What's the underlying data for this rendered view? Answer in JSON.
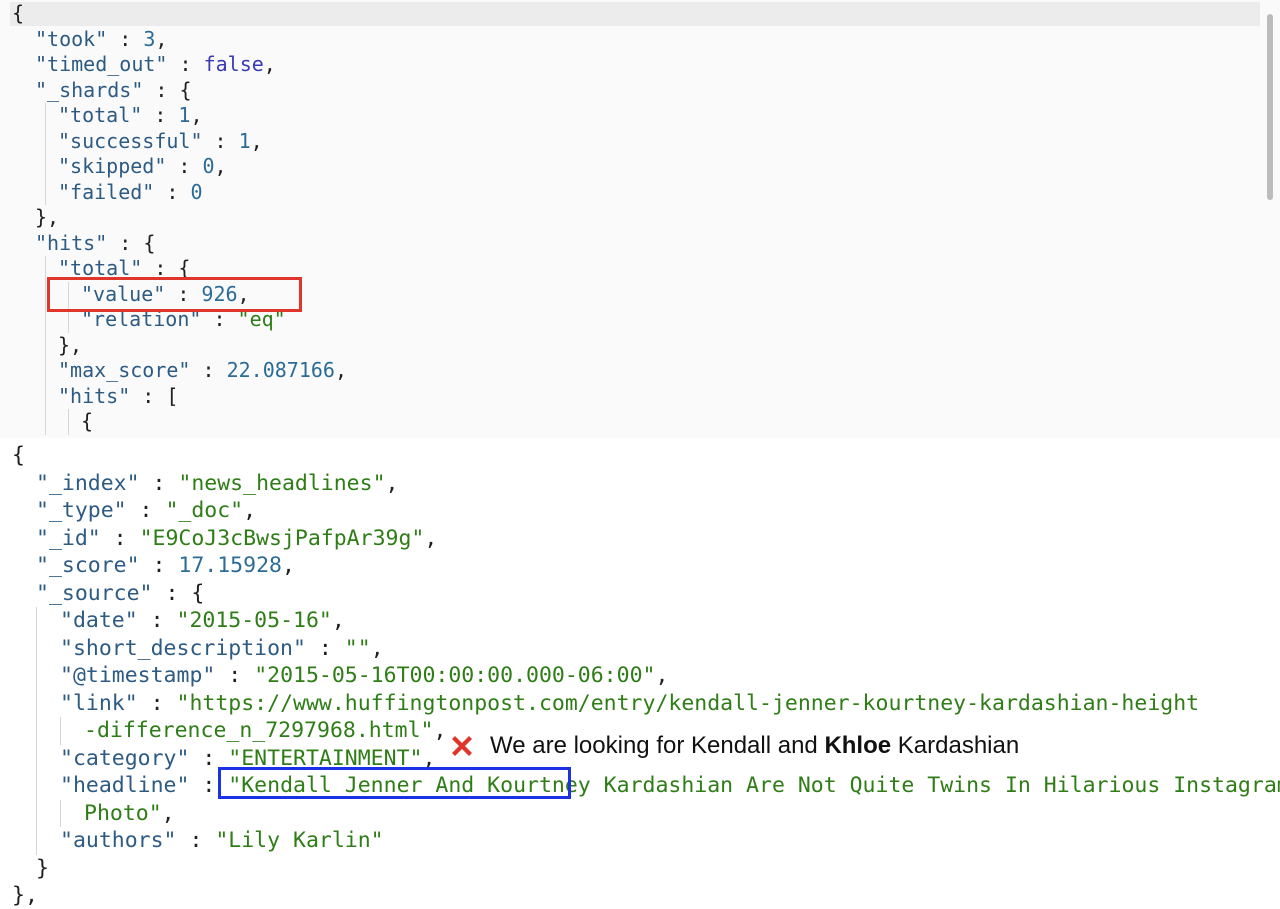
{
  "top_panel": {
    "lines": [
      {
        "indent": 0,
        "tokens": [
          {
            "t": "{",
            "c": "p"
          }
        ]
      },
      {
        "indent": 1,
        "tokens": [
          {
            "t": "\"took\"",
            "c": "k"
          },
          {
            "t": " : ",
            "c": "p"
          },
          {
            "t": "3",
            "c": "n"
          },
          {
            "t": ",",
            "c": "p"
          }
        ]
      },
      {
        "indent": 1,
        "tokens": [
          {
            "t": "\"timed_out\"",
            "c": "k"
          },
          {
            "t": " : ",
            "c": "p"
          },
          {
            "t": "false",
            "c": "b"
          },
          {
            "t": ",",
            "c": "p"
          }
        ]
      },
      {
        "indent": 1,
        "tokens": [
          {
            "t": "\"_shards\"",
            "c": "k"
          },
          {
            "t": " : {",
            "c": "p"
          }
        ]
      },
      {
        "indent": 2,
        "tokens": [
          {
            "t": "\"total\"",
            "c": "k"
          },
          {
            "t": " : ",
            "c": "p"
          },
          {
            "t": "1",
            "c": "n"
          },
          {
            "t": ",",
            "c": "p"
          }
        ]
      },
      {
        "indent": 2,
        "tokens": [
          {
            "t": "\"successful\"",
            "c": "k"
          },
          {
            "t": " : ",
            "c": "p"
          },
          {
            "t": "1",
            "c": "n"
          },
          {
            "t": ",",
            "c": "p"
          }
        ]
      },
      {
        "indent": 2,
        "tokens": [
          {
            "t": "\"skipped\"",
            "c": "k"
          },
          {
            "t": " : ",
            "c": "p"
          },
          {
            "t": "0",
            "c": "n"
          },
          {
            "t": ",",
            "c": "p"
          }
        ]
      },
      {
        "indent": 2,
        "tokens": [
          {
            "t": "\"failed\"",
            "c": "k"
          },
          {
            "t": " : ",
            "c": "p"
          },
          {
            "t": "0",
            "c": "n"
          }
        ]
      },
      {
        "indent": 1,
        "tokens": [
          {
            "t": "},",
            "c": "p"
          }
        ]
      },
      {
        "indent": 1,
        "tokens": [
          {
            "t": "\"hits\"",
            "c": "k"
          },
          {
            "t": " : {",
            "c": "p"
          }
        ]
      },
      {
        "indent": 2,
        "tokens": [
          {
            "t": "\"total\"",
            "c": "k"
          },
          {
            "t": " : {",
            "c": "p"
          }
        ]
      },
      {
        "indent": 3,
        "tokens": [
          {
            "t": "\"value\"",
            "c": "k"
          },
          {
            "t": " : ",
            "c": "p"
          },
          {
            "t": "926",
            "c": "n"
          },
          {
            "t": ",",
            "c": "p"
          }
        ]
      },
      {
        "indent": 3,
        "tokens": [
          {
            "t": "\"relation\"",
            "c": "k"
          },
          {
            "t": " : ",
            "c": "p"
          },
          {
            "t": "\"eq\"",
            "c": "s"
          }
        ]
      },
      {
        "indent": 2,
        "tokens": [
          {
            "t": "},",
            "c": "p"
          }
        ]
      },
      {
        "indent": 2,
        "tokens": [
          {
            "t": "\"max_score\"",
            "c": "k"
          },
          {
            "t": " : ",
            "c": "p"
          },
          {
            "t": "22.087166",
            "c": "n"
          },
          {
            "t": ",",
            "c": "p"
          }
        ]
      },
      {
        "indent": 2,
        "tokens": [
          {
            "t": "\"hits\"",
            "c": "k"
          },
          {
            "t": " : [",
            "c": "p"
          }
        ]
      },
      {
        "indent": 3,
        "tokens": [
          {
            "t": "{",
            "c": "p"
          }
        ]
      }
    ]
  },
  "bottom_panel": {
    "lines": [
      {
        "indent": 0,
        "tokens": [
          {
            "t": "{",
            "c": "p"
          }
        ]
      },
      {
        "indent": 1,
        "tokens": [
          {
            "t": "\"_index\"",
            "c": "k"
          },
          {
            "t": " : ",
            "c": "p"
          },
          {
            "t": "\"news_headlines\"",
            "c": "s"
          },
          {
            "t": ",",
            "c": "p"
          }
        ]
      },
      {
        "indent": 1,
        "tokens": [
          {
            "t": "\"_type\"",
            "c": "k"
          },
          {
            "t": " : ",
            "c": "p"
          },
          {
            "t": "\"_doc\"",
            "c": "s"
          },
          {
            "t": ",",
            "c": "p"
          }
        ]
      },
      {
        "indent": 1,
        "tokens": [
          {
            "t": "\"_id\"",
            "c": "k"
          },
          {
            "t": " : ",
            "c": "p"
          },
          {
            "t": "\"E9CoJ3cBwsjPafpAr39g\"",
            "c": "s"
          },
          {
            "t": ",",
            "c": "p"
          }
        ]
      },
      {
        "indent": 1,
        "tokens": [
          {
            "t": "\"_score\"",
            "c": "k"
          },
          {
            "t": " : ",
            "c": "p"
          },
          {
            "t": "17.15928",
            "c": "n"
          },
          {
            "t": ",",
            "c": "p"
          }
        ]
      },
      {
        "indent": 1,
        "tokens": [
          {
            "t": "\"_source\"",
            "c": "k"
          },
          {
            "t": " : {",
            "c": "p"
          }
        ]
      },
      {
        "indent": 2,
        "tokens": [
          {
            "t": "\"date\"",
            "c": "k"
          },
          {
            "t": " : ",
            "c": "p"
          },
          {
            "t": "\"2015-05-16\"",
            "c": "s"
          },
          {
            "t": ",",
            "c": "p"
          }
        ]
      },
      {
        "indent": 2,
        "tokens": [
          {
            "t": "\"short_description\"",
            "c": "k"
          },
          {
            "t": " : ",
            "c": "p"
          },
          {
            "t": "\"\"",
            "c": "s"
          },
          {
            "t": ",",
            "c": "p"
          }
        ]
      },
      {
        "indent": 2,
        "tokens": [
          {
            "t": "\"@timestamp\"",
            "c": "k"
          },
          {
            "t": " : ",
            "c": "p"
          },
          {
            "t": "\"2015-05-16T00:00:00.000-06:00\"",
            "c": "s"
          },
          {
            "t": ",",
            "c": "p"
          }
        ]
      },
      {
        "indent": 2,
        "tokens": [
          {
            "t": "\"link\"",
            "c": "k"
          },
          {
            "t": " : ",
            "c": "p"
          },
          {
            "t": "\"https://www.huffingtonpost.com/entry/kendall-jenner-kourtney-kardashian-height",
            "c": "s"
          }
        ]
      },
      {
        "indent": 3,
        "tokens": [
          {
            "t": "-difference_n_7297968.html\"",
            "c": "s"
          },
          {
            "t": ",",
            "c": "p"
          }
        ]
      },
      {
        "indent": 2,
        "tokens": [
          {
            "t": "\"category\"",
            "c": "k"
          },
          {
            "t": " : ",
            "c": "p"
          },
          {
            "t": "\"ENTERTAINMENT\"",
            "c": "s"
          },
          {
            "t": ",",
            "c": "p"
          }
        ]
      },
      {
        "indent": 2,
        "tokens": [
          {
            "t": "\"headline\"",
            "c": "k"
          },
          {
            "t": " : ",
            "c": "p"
          },
          {
            "t": "\"Kendall Jenner And Kourtney Kardashian Are Not Quite Twins In Hilarious Instagram",
            "c": "s"
          }
        ]
      },
      {
        "indent": 3,
        "tokens": [
          {
            "t": "Photo\"",
            "c": "s"
          },
          {
            "t": ",",
            "c": "p"
          }
        ]
      },
      {
        "indent": 2,
        "tokens": [
          {
            "t": "\"authors\"",
            "c": "k"
          },
          {
            "t": " : ",
            "c": "p"
          },
          {
            "t": "\"Lily Karlin\"",
            "c": "s"
          }
        ]
      },
      {
        "indent": 1,
        "tokens": [
          {
            "t": "}",
            "c": "p"
          }
        ]
      },
      {
        "indent": 0,
        "tokens": [
          {
            "t": "},",
            "c": "p"
          }
        ]
      }
    ]
  },
  "annotation": {
    "icon": "red-x-icon",
    "text_before": "We are looking for Kendall and ",
    "text_bold": "Khloe",
    "text_after": " Kardashian"
  },
  "colors": {
    "key": "#2d5b83",
    "string": "#2e7d16",
    "number": "#2b6c97",
    "boolean": "#3a3ab8",
    "highlight_red": "#e0352b",
    "highlight_blue": "#1a31e6"
  }
}
